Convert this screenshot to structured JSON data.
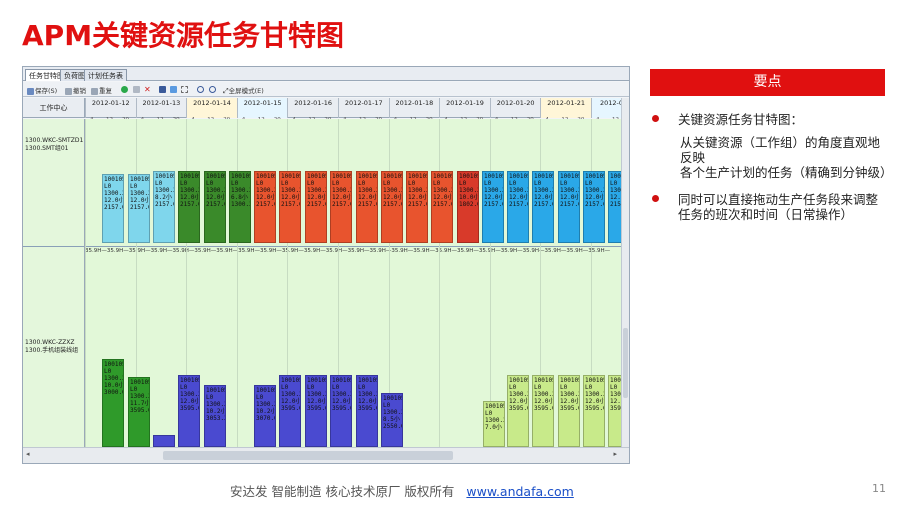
{
  "slide": {
    "title": "APM关键资源任务甘特图",
    "page_number": "11"
  },
  "gantt": {
    "tabs": [
      "任务甘特图",
      "负荷图",
      "计划任务表"
    ],
    "toolbar": [
      "保存(S)",
      "撤销",
      "重复",
      "全屏模式(E)"
    ],
    "header_left": "工作中心",
    "dates": [
      "2012-01-12",
      "2012-01-13",
      "2012-01-14",
      "2012-01-15",
      "2012-01-16",
      "2012-01-17",
      "2012-01-18",
      "2012-01-19",
      "2012-01-20",
      "2012-01-21",
      "2012-01-2"
    ],
    "hours": [
      "4",
      "12",
      "20"
    ],
    "rows": [
      {
        "label": "1300.WKC-SMTZD1\n1300.SMT组01"
      },
      {
        "label": "1300.WKC-ZZXZ\n1300.手机组装线组"
      }
    ],
    "capacity_label": "35.9H",
    "tasks_top": [
      {
        "text": "100105\nL0\n1300.3\n12.0小\n2157.0",
        "color": "#7fd6ec"
      },
      {
        "text": "100105\nL0\n1300.3\n12.0小\n2157.0",
        "color": "#7fd6ec"
      },
      {
        "text": "100105\nL0\n1300.3\n8.2小\n2157.0",
        "color": "#7fd6ec"
      },
      {
        "text": "100105\nL0\n1300.3\n12.0小\n2157.0",
        "color": "#3a8a2a"
      },
      {
        "text": "100105\nL0\n1300.3\n12.0小\n2157.0",
        "color": "#3a8a2a"
      },
      {
        "text": "100105\nL0\n1300.3\n6.8小\n1300.3",
        "color": "#3a8a2a"
      },
      {
        "text": "100105\nL0\n1300.3\n12.0小\n2157.0",
        "color": "#e8542e"
      },
      {
        "text": "100105\nL0\n1300.3\n12.0小\n2157.0",
        "color": "#e8542e"
      },
      {
        "text": "100105\nL0\n1300.3\n12.0小\n2157.0",
        "color": "#e8542e"
      },
      {
        "text": "100105\nL0\n1300.3\n12.0小\n2157.0",
        "color": "#e8542e"
      },
      {
        "text": "100105\nL0\n1300.3\n12.0小\n2157.0",
        "color": "#e8542e"
      },
      {
        "text": "100105\nL0\n1300.3\n12.0小\n2157.0",
        "color": "#e8542e"
      },
      {
        "text": "100105\nL0\n1300.3\n12.0小\n2157.0",
        "color": "#e8542e"
      },
      {
        "text": "100105\nL0\n1300.3\n12.0小\n2157.0",
        "color": "#e8542e"
      },
      {
        "text": "100105\nL0\n1300.3\n10.0小\n1802.0",
        "color": "#d83a2a"
      },
      {
        "text": "100105\nL0\n1300.3\n12.0小\n2157.0",
        "color": "#2aa8e8"
      },
      {
        "text": "100105\nL0\n1300.3\n12.0小\n2157.0",
        "color": "#2aa8e8"
      },
      {
        "text": "100105\nL0\n1300.3\n12.0小\n2157.0",
        "color": "#2aa8e8"
      },
      {
        "text": "100105\nL0\n1300.3\n12.0小\n2157.0",
        "color": "#2aa8e8"
      },
      {
        "text": "100105\nL0\n1300.3\n12.0小\n2157.0",
        "color": "#2aa8e8"
      },
      {
        "text": "100105\nL0\n1300.3\n12.0小\n2157.0",
        "color": "#2aa8e8"
      }
    ],
    "tasks_bottom": [
      {
        "text": "100105\nL0\n1300.3\n10.0小\n3000.0",
        "color": "#2f9a2a"
      },
      {
        "text": "100105\nL0\n1300.3\n11.7小\n3595.0",
        "color": "#2f9a2a"
      },
      {
        "text": "",
        "color": "#4a4ad0"
      },
      {
        "text": "100105\nL0\n1300.3\n12.0小\n3595.0",
        "color": "#4a4ad0"
      },
      {
        "text": "100105\nL0\n1300.3\n10.2小\n3053.3",
        "color": "#4a4ad0"
      },
      {
        "text": "100105\nL0\n1300.3\n10.2小\n3070.0",
        "color": "#4a4ad0"
      },
      {
        "text": "100105\nL0\n1300.3\n12.0小\n3595.0",
        "color": "#4a4ad0"
      },
      {
        "text": "100105\nL0\n1300.3\n12.0小\n3595.0",
        "color": "#4a4ad0"
      },
      {
        "text": "100105\nL0\n1300.3\n12.0小\n3595.0",
        "color": "#4a4ad0"
      },
      {
        "text": "100105\nL0\n1300.3\n12.0小\n3595.0",
        "color": "#4a4ad0"
      },
      {
        "text": "100105\nL0\n1300.3\n8.5小\n2550.0",
        "color": "#4a4ad0"
      },
      {
        "text": "100105\nL0\n1300.3\n7.0小",
        "color": "#c8ea8a"
      },
      {
        "text": "100105\nL0\n1300.3\n12.0小\n3595.0",
        "color": "#c8ea8a"
      },
      {
        "text": "100105\nL0\n1300.3\n12.0小\n3595.0",
        "color": "#c8ea8a"
      },
      {
        "text": "100105\nL0\n1300.3\n12.0小\n3595.0",
        "color": "#c8ea8a"
      },
      {
        "text": "100105\nL0\n1300.3\n12.0小\n3595.0",
        "color": "#c8ea8a"
      },
      {
        "text": "100105\nL0\n1300.3\n12.0小\n3595.0",
        "color": "#c8ea8a"
      },
      {
        "text": "100\nL0\n130\n12.\n359",
        "color": "#c8ea8a"
      }
    ]
  },
  "points": {
    "header": "要点",
    "item1": "关键资源任务甘特图：",
    "item1_sub1": "从关键资源（工作组）的角度直观地反映",
    "item1_sub2": "各个生产计划的任务（精确到分钟级）",
    "item2": "同时可以直接拖动生产任务段来调整任务的班次和时间（日常操作）"
  },
  "footer": {
    "text": "安达发  智能制造 核心技术原厂  版权所有",
    "link": "www.andafa.com"
  }
}
